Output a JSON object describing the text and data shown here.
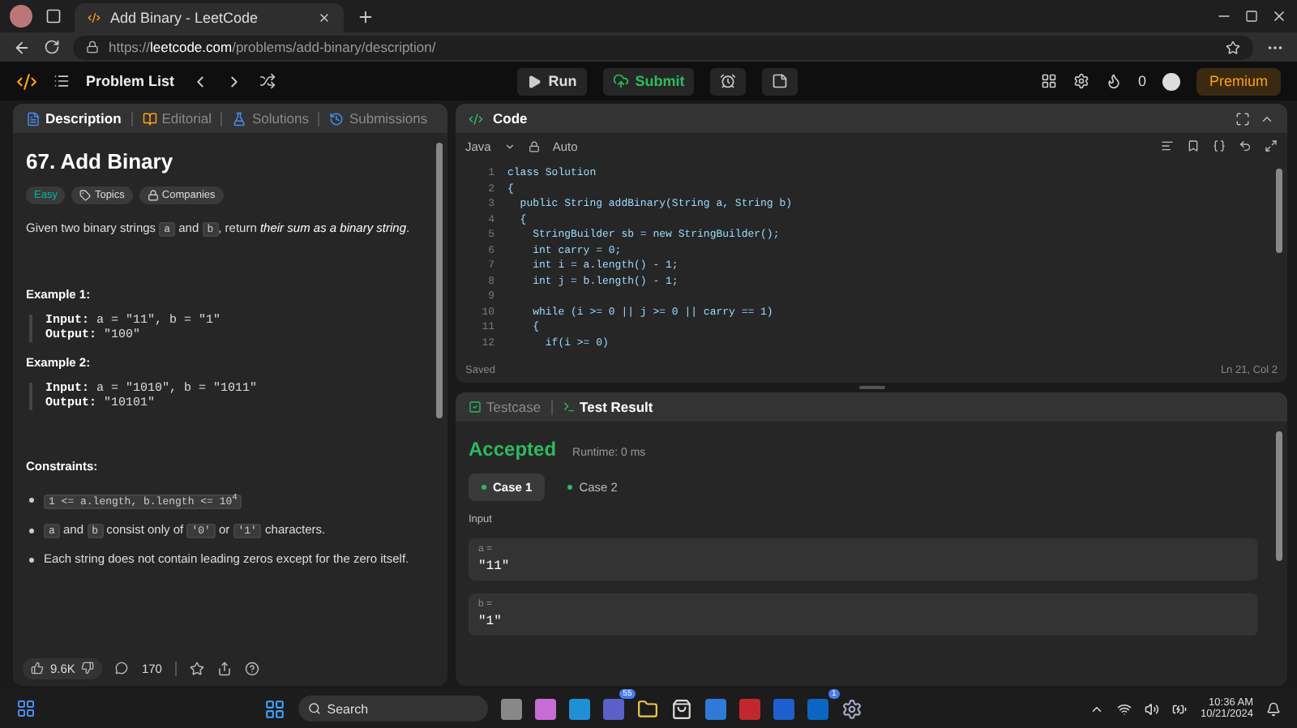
{
  "browser": {
    "tab_title": "Add Binary - LeetCode",
    "url": "https://**leetcode.com**/problems/add-binary/description/"
  },
  "navbar": {
    "problem_list": "Problem List",
    "run": "Run",
    "submit": "Submit",
    "streak": "0",
    "premium": "Premium"
  },
  "left_tabs": [
    {
      "label": "Description",
      "selected": true
    },
    {
      "label": "Editorial",
      "selected": false
    },
    {
      "label": "Solutions",
      "selected": false
    },
    {
      "label": "Submissions",
      "selected": false
    }
  ],
  "problem": {
    "title": "67. Add Binary",
    "difficulty": "Easy",
    "tags": [
      "Topics",
      "Companies"
    ],
    "statement": [
      {
        "kind": "text",
        "text": "Given two binary strings "
      },
      {
        "kind": "code",
        "text": "a"
      },
      {
        "kind": "text",
        "text": " and "
      },
      {
        "kind": "code",
        "text": "b"
      },
      {
        "kind": "text",
        "text": ", return "
      },
      {
        "kind": "em",
        "text": "their sum as a binary string"
      },
      {
        "kind": "text",
        "text": "."
      }
    ],
    "examples": [
      {
        "title": "Example 1:",
        "input_label": "Input:",
        "input": "a = \"11\", b = \"1\"",
        "output_label": "Output:",
        "output": "\"100\""
      },
      {
        "title": "Example 2:",
        "input_label": "Input:",
        "input": "a = \"1010\", b = \"1011\"",
        "output_label": "Output:",
        "output": "\"10101\""
      }
    ],
    "constraints_title": "Constraints:",
    "constraints": [
      [
        {
          "kind": "code",
          "text": "1 <= a.length, b.length <= 10$^{4}$"
        }
      ],
      [
        {
          "kind": "code",
          "text": "a"
        },
        {
          "kind": "text",
          "text": " and "
        },
        {
          "kind": "code",
          "text": "b"
        },
        {
          "kind": "text",
          "text": " consist only of "
        },
        {
          "kind": "code",
          "text": "'0'"
        },
        {
          "kind": "text",
          "text": " or "
        },
        {
          "kind": "code",
          "text": "'1'"
        },
        {
          "kind": "text",
          "text": " characters."
        }
      ],
      [
        {
          "kind": "text",
          "text": "Each string does not contain leading zeros except for the zero itself."
        }
      ]
    ],
    "likes": "9.6K",
    "comments": "170"
  },
  "code": {
    "title": "Code",
    "language": "Java",
    "mode": "Auto",
    "status": "Saved",
    "cursor": "Ln 21, Col 2",
    "lines": [
      {
        "n": "1",
        "text": "class Solution"
      },
      {
        "n": "2",
        "text": "{"
      },
      {
        "n": "3",
        "text": "  public String addBinary(String a, String b)"
      },
      {
        "n": "4",
        "text": "  {"
      },
      {
        "n": "5",
        "text": "    StringBuilder sb = new StringBuilder();"
      },
      {
        "n": "6",
        "text": "    int carry = 0;"
      },
      {
        "n": "7",
        "text": "    int i = a.length() - 1;"
      },
      {
        "n": "8",
        "text": "    int j = b.length() - 1;"
      },
      {
        "n": "9"
      },
      {
        "n": "10",
        "text": "    while (i >= 0 || j >= 0 || carry == 1)"
      },
      {
        "n": "11",
        "text": "    {"
      },
      {
        "n": "12",
        "text": "      if(i >= 0)"
      }
    ]
  },
  "result_tabs": [
    {
      "label": "Testcase",
      "selected": false
    },
    {
      "label": "Test Result",
      "selected": true
    }
  ],
  "result": {
    "verdict": "Accepted",
    "runtime": "Runtime: 0 ms",
    "cases": [
      {
        "label": "Case 1",
        "selected": true
      },
      {
        "label": "Case 2",
        "selected": false
      }
    ],
    "input_label": "Input",
    "inputs": [
      {
        "name": "a =",
        "value": "\"11\""
      },
      {
        "name": "b =",
        "value": "\"1\""
      }
    ]
  },
  "taskbar": {
    "search": "Search",
    "badges": [
      "55",
      "1"
    ],
    "time": "10:36 AM",
    "date": "10/21/2024"
  }
}
